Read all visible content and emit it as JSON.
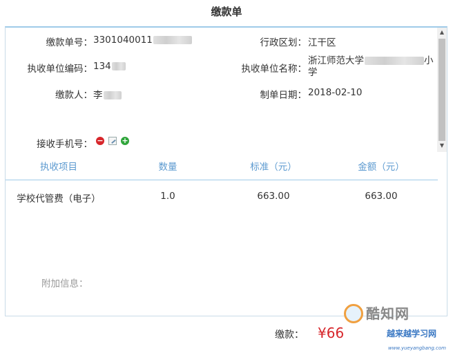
{
  "page": {
    "title": "缴款单"
  },
  "info": {
    "payment_no_label": "缴款单号：",
    "payment_no_value": "3301040011",
    "district_label": "行政区划：",
    "district_value": "江干区",
    "unit_code_label": "执收单位编码：",
    "unit_code_value": "134",
    "unit_name_label": "执收单位名称：",
    "unit_name_value_1": "浙江师范大学",
    "unit_name_value_2": "小",
    "unit_name_value_3": "学",
    "payer_label": "缴款人：",
    "payer_value": "李",
    "date_label": "制单日期：",
    "date_value": "2018-02-10",
    "phone_label": "接收手机号："
  },
  "icons": {
    "remove": "minus-circle-icon",
    "edit": "edit-note-icon",
    "add": "plus-circle-icon",
    "remove_glyph": "−",
    "add_glyph": "+"
  },
  "table": {
    "headers": [
      "执收项目",
      "数量",
      "标准（元）",
      "金额（元）"
    ],
    "rows": [
      [
        "学校代管费（电子）",
        "1.0",
        "663.00",
        "663.00"
      ]
    ]
  },
  "extra": {
    "label": "附加信息："
  },
  "footer": {
    "total_label": "缴款：",
    "total_amount": "¥66"
  },
  "watermark": {
    "brand": "酷知网",
    "brand2": "越来越学习网",
    "url": "www.yueyangbang.com"
  },
  "colors": {
    "header_blue": "#5c9ad0",
    "border_blue": "#9ecae8",
    "amount_red": "#d7262b"
  }
}
